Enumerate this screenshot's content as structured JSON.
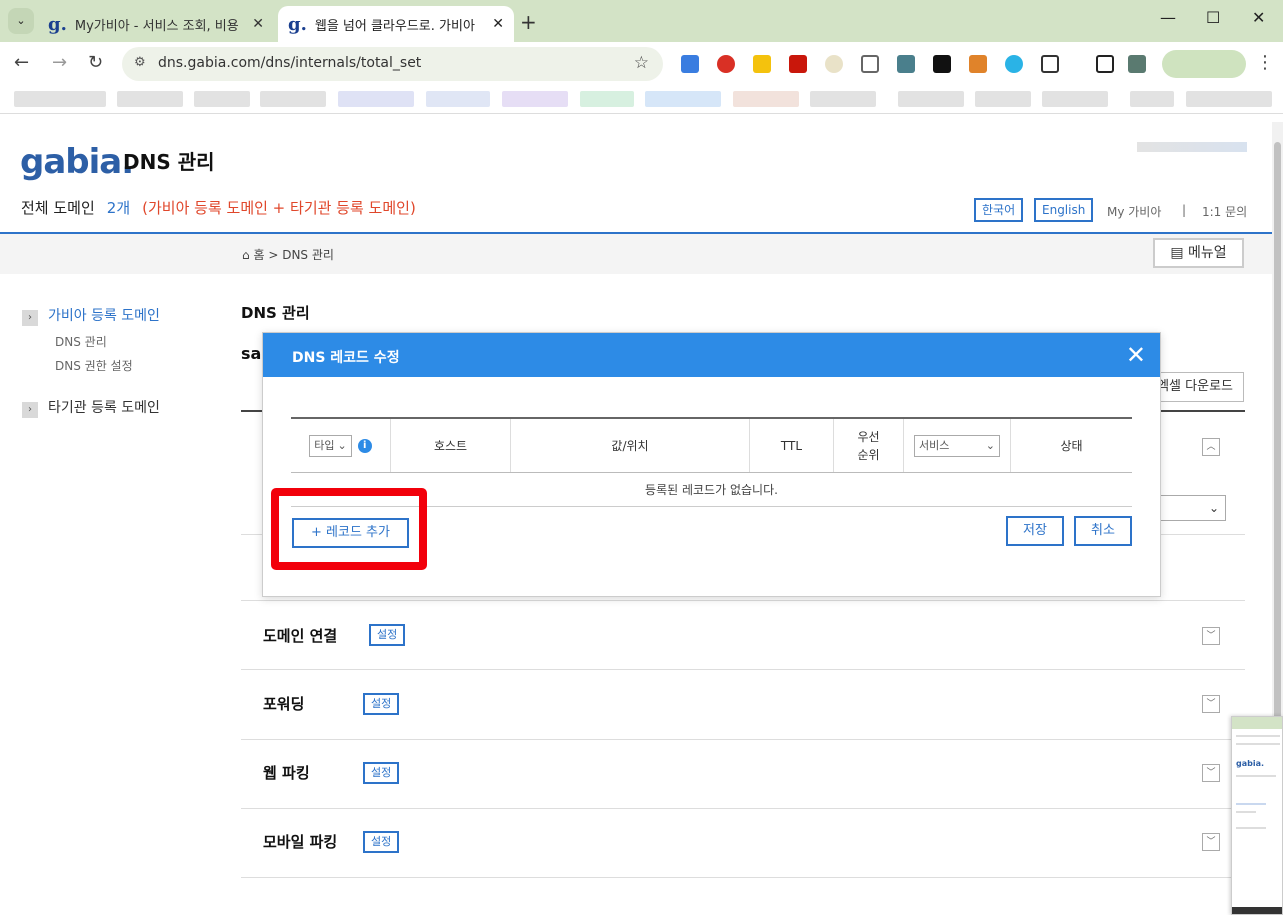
{
  "browser": {
    "tabs": [
      {
        "title": "My가비아 - 서비스 조회, 비용",
        "favicon": "g."
      },
      {
        "title": "웹을 넘어 클라우드로. 가비아",
        "favicon": "g."
      }
    ],
    "url": "dns.gabia.com/dns/internals/total_set",
    "new_tab": "+",
    "close": "✕"
  },
  "header": {
    "logo": "gabia.",
    "title": "DNS 관리",
    "total_label": "전체 도메인",
    "total_count": "2개",
    "total_note": "(가비아 등록 도메인 + 타기관 등록 도메인)",
    "lang_ko": "한국어",
    "lang_en": "English",
    "my_gabia": "My 가비아",
    "separator": "|",
    "inquiry": "1:1 문의"
  },
  "breadcrumb": {
    "home": "홈",
    "sep": ">",
    "current": "DNS 관리",
    "manual": "메뉴얼"
  },
  "sidebar": {
    "group1": "가비아 등록 도메인",
    "group1_items": [
      "DNS 관리",
      "DNS 권한 설정"
    ],
    "group2": "타기관 등록 도메인"
  },
  "main": {
    "title": "DNS 관리",
    "sub": "sa",
    "excel": "엑셀 다운로드",
    "sections": [
      {
        "title": "도메인 연결",
        "button": "설정"
      },
      {
        "title": "포워딩",
        "button": "설정"
      },
      {
        "title": "웹 파킹",
        "button": "설정"
      },
      {
        "title": "모바일 파킹",
        "button": "설정"
      }
    ]
  },
  "modal": {
    "title": "DNS 레코드 수정",
    "close": "✕",
    "columns": {
      "type": "타입",
      "host": "호스트",
      "value": "값/위치",
      "ttl": "TTL",
      "priority": "우선\n순위",
      "service": "서비스",
      "status": "상태"
    },
    "empty": "등록된 레코드가 없습니다.",
    "add_record": "+ 레코드 추가",
    "save": "저장",
    "cancel": "취소"
  },
  "colors": {
    "accent": "#2d8be6",
    "brand": "#2d5fa6",
    "highlight": "#f2000b",
    "note": "#e0472b"
  }
}
